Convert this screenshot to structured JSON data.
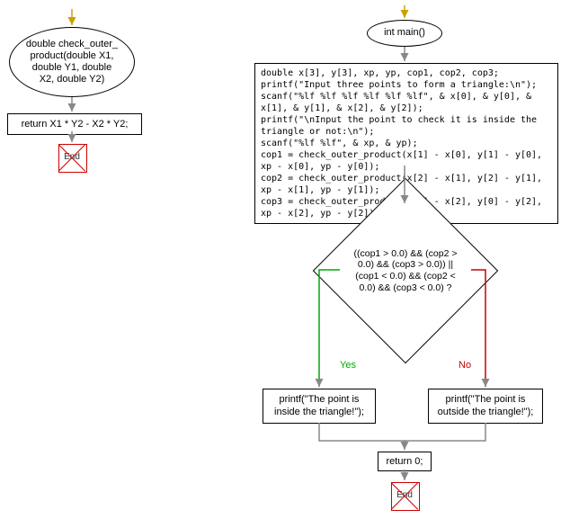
{
  "left": {
    "func_signature": "double check_outer_\nproduct(double X1,\ndouble Y1, double\nX2, double Y2)",
    "return_stmt": "return X1 * Y2 - X2 * Y2;",
    "end": "End"
  },
  "right": {
    "main_signature": "int main()",
    "body": "double x[3], y[3], xp, yp, cop1, cop2, cop3;\nprintf(\"Input three points to form a triangle:\\n\");\nscanf(\"%lf %lf %lf %lf %lf %lf\", & x[0], & y[0], & x[1], & y[1], & x[2], & y[2]);\nprintf(\"\\nInput the point to check it is inside the triangle or not:\\n\");\nscanf(\"%lf %lf\", & xp, & yp);\ncop1 = check_outer_product(x[1] - x[0], y[1] - y[0], xp - x[0], yp - y[0]);\ncop2 = check_outer_product(x[2] - x[1], y[2] - y[1], xp - x[1], yp - y[1]);\ncop3 = check_outer_product(x[0] - x[2], y[0] - y[2], xp - x[2], yp - y[2]);",
    "condition": "((cop1 > 0.0) && (cop2 >\n0.0) && (cop3 > 0.0)) ||\n(cop1 < 0.0) && (cop2 <\n0.0) && (cop3 < 0.0) ?",
    "yes_label": "Yes",
    "no_label": "No",
    "inside": "printf(\"The point is\ninside the triangle!\");",
    "outside": "printf(\"The point is\noutside the triangle!\");",
    "ret0": "return 0;",
    "end": "End"
  }
}
